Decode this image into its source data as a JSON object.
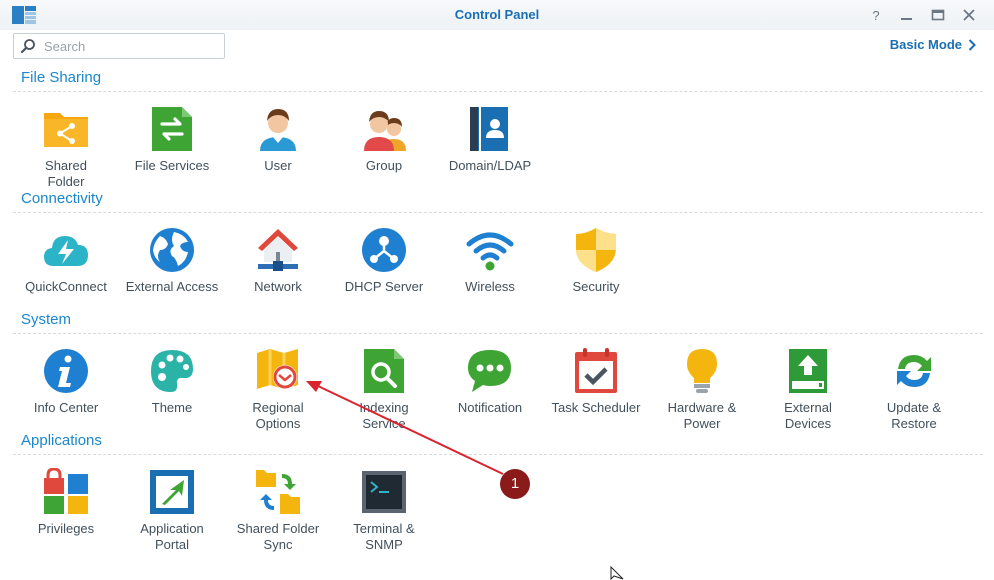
{
  "window": {
    "title": "Control Panel"
  },
  "search": {
    "placeholder": "Search"
  },
  "basic_mode": {
    "label": "Basic Mode"
  },
  "sections": [
    {
      "title": "File Sharing",
      "items": [
        {
          "line1": "Shared",
          "line2": "Folder",
          "icon": "shared-folder-icon"
        },
        {
          "line1": "File Services",
          "line2": "",
          "icon": "file-services-icon"
        },
        {
          "line1": "User",
          "line2": "",
          "icon": "user-icon"
        },
        {
          "line1": "Group",
          "line2": "",
          "icon": "group-icon"
        },
        {
          "line1": "Domain/LDAP",
          "line2": "",
          "icon": "domain-ldap-icon"
        }
      ]
    },
    {
      "title": "Connectivity",
      "items": [
        {
          "line1": "QuickConnect",
          "line2": "",
          "icon": "quickconnect-icon"
        },
        {
          "line1": "External Access",
          "line2": "",
          "icon": "external-access-icon"
        },
        {
          "line1": "Network",
          "line2": "",
          "icon": "network-icon"
        },
        {
          "line1": "DHCP Server",
          "line2": "",
          "icon": "dhcp-server-icon"
        },
        {
          "line1": "Wireless",
          "line2": "",
          "icon": "wireless-icon"
        },
        {
          "line1": "Security",
          "line2": "",
          "icon": "security-icon"
        }
      ]
    },
    {
      "title": "System",
      "items": [
        {
          "line1": "Info Center",
          "line2": "",
          "icon": "info-center-icon"
        },
        {
          "line1": "Theme",
          "line2": "",
          "icon": "theme-icon"
        },
        {
          "line1": "Regional",
          "line2": "Options",
          "icon": "regional-options-icon"
        },
        {
          "line1": "Indexing",
          "line2": "Service",
          "icon": "indexing-service-icon"
        },
        {
          "line1": "Notification",
          "line2": "",
          "icon": "notification-icon"
        },
        {
          "line1": "Task Scheduler",
          "line2": "",
          "icon": "task-scheduler-icon"
        },
        {
          "line1": "Hardware &",
          "line2": "Power",
          "icon": "hardware-power-icon"
        },
        {
          "line1": "External",
          "line2": "Devices",
          "icon": "external-devices-icon"
        },
        {
          "line1": "Update &",
          "line2": "Restore",
          "icon": "update-restore-icon"
        }
      ]
    },
    {
      "title": "Applications",
      "items": [
        {
          "line1": "Privileges",
          "line2": "",
          "icon": "privileges-icon"
        },
        {
          "line1": "Application",
          "line2": "Portal",
          "icon": "application-portal-icon"
        },
        {
          "line1": "Shared Folder",
          "line2": "Sync",
          "icon": "shared-folder-sync-icon"
        },
        {
          "line1": "Terminal &",
          "line2": "SNMP",
          "icon": "terminal-snmp-icon"
        }
      ]
    }
  ],
  "annotation": {
    "badge": "1",
    "color": "#8b1a1a",
    "arrow_color": "#d9232d"
  },
  "colors": {
    "accent": "#1a87cd",
    "title": "#1a6fb3"
  }
}
